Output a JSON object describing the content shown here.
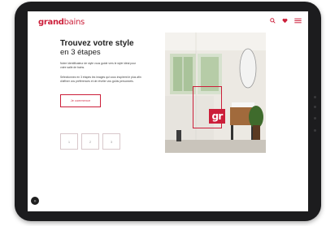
{
  "header": {
    "logo_bold": "grand",
    "logo_light": "bains",
    "icons": [
      "search-icon",
      "heart-icon",
      "menu-icon"
    ]
  },
  "hero": {
    "title": "Trouvez votre style",
    "subtitle": "en 3 étapes",
    "paragraph_1": "Notre identificateur de style vous guide vers le style idéal pour votre salle de bains.",
    "paragraph_2": "Sélectionnez en 3 étapes les images qui vous inspirent le plus afin d'affiner vos préférences et de révéler vos goûts personnels.",
    "cta_label": "Je commence"
  },
  "steps": [
    "1",
    "2",
    "3"
  ],
  "photo": {
    "badge": "gr"
  },
  "chat": {
    "label": "◎"
  },
  "colors": {
    "brand": "#cc1f3a",
    "device": "#1c1c1e"
  }
}
